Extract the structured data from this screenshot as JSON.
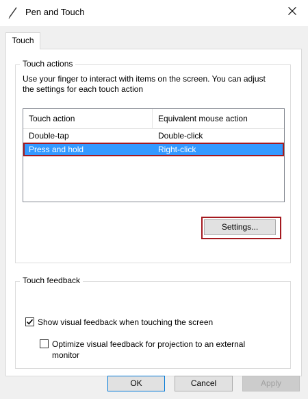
{
  "window": {
    "title": "Pen and Touch",
    "icon": "pen-icon",
    "close_icon": "close-icon"
  },
  "tabs": [
    {
      "label": "Touch",
      "active": true
    }
  ],
  "touch_actions": {
    "legend": "Touch actions",
    "description": "Use your finger to interact with items on the screen. You can adjust the settings for each touch action",
    "columns": [
      "Touch action",
      "Equivalent mouse action"
    ],
    "rows": [
      {
        "action": "Double-tap",
        "mouse": "Double-click",
        "selected": false
      },
      {
        "action": "Press and hold",
        "mouse": "Right-click",
        "selected": true
      }
    ],
    "settings_button": "Settings..."
  },
  "touch_feedback": {
    "legend": "Touch feedback",
    "show_visual_feedback": {
      "label": "Show visual feedback when touching the screen",
      "checked": true
    },
    "optimize_feedback": {
      "label": "Optimize visual feedback for projection to an external monitor",
      "checked": false
    }
  },
  "footer": {
    "ok": "OK",
    "cancel": "Cancel",
    "apply": "Apply",
    "apply_enabled": false
  },
  "colors": {
    "selection": "#3399ff",
    "highlight_outline": "#a4191f",
    "dialog_background": "#f0f0f0"
  }
}
